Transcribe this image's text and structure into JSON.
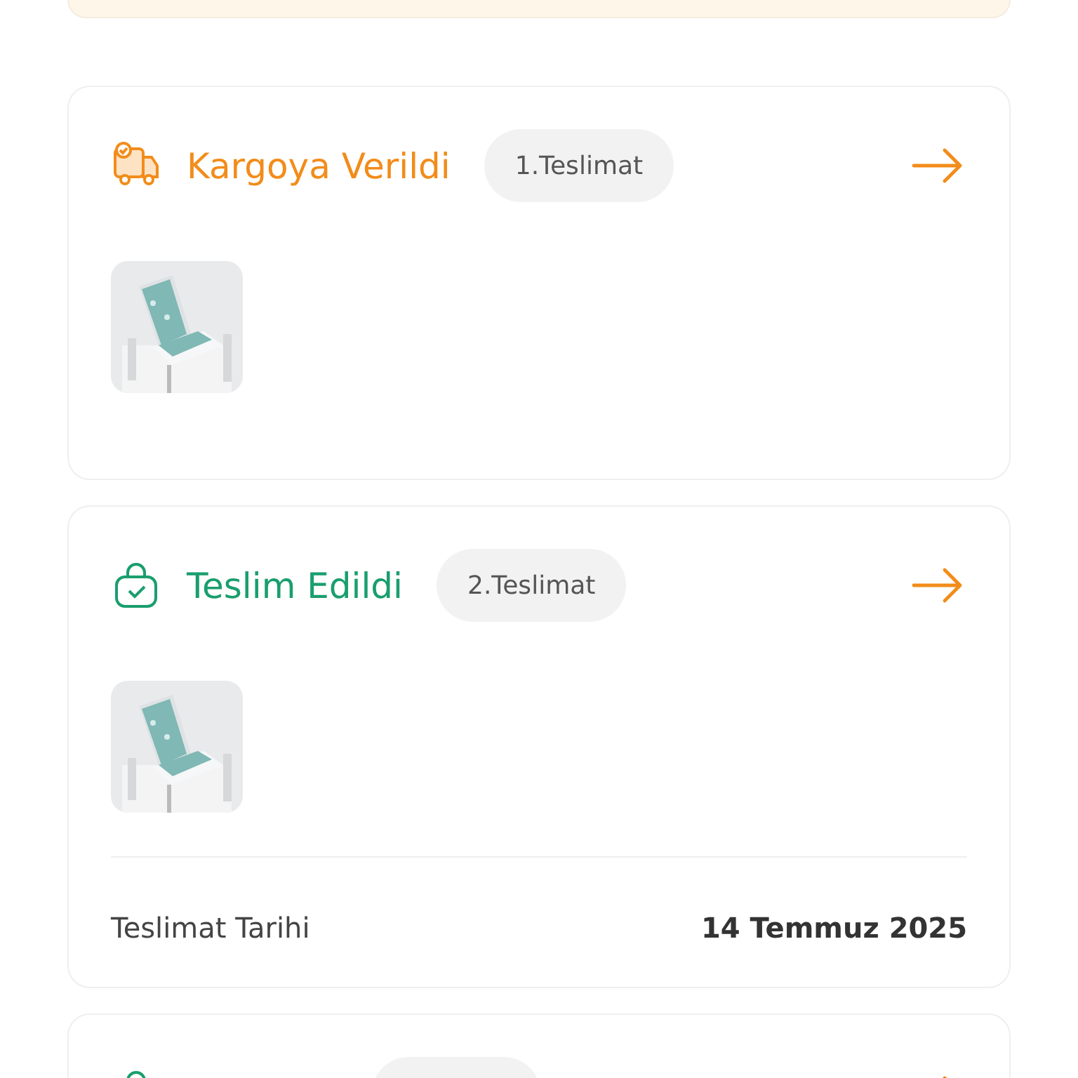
{
  "deliveries": [
    {
      "kind": "shipped",
      "status": "Kargoya Verildi",
      "badge": "1.Teslimat"
    },
    {
      "kind": "delivered",
      "status": "Teslim Edildi",
      "badge": "2.Teslimat",
      "date_label": "Teslimat Tarihi",
      "date": "14 Temmuz 2025"
    },
    {
      "kind": "delivered"
    }
  ]
}
